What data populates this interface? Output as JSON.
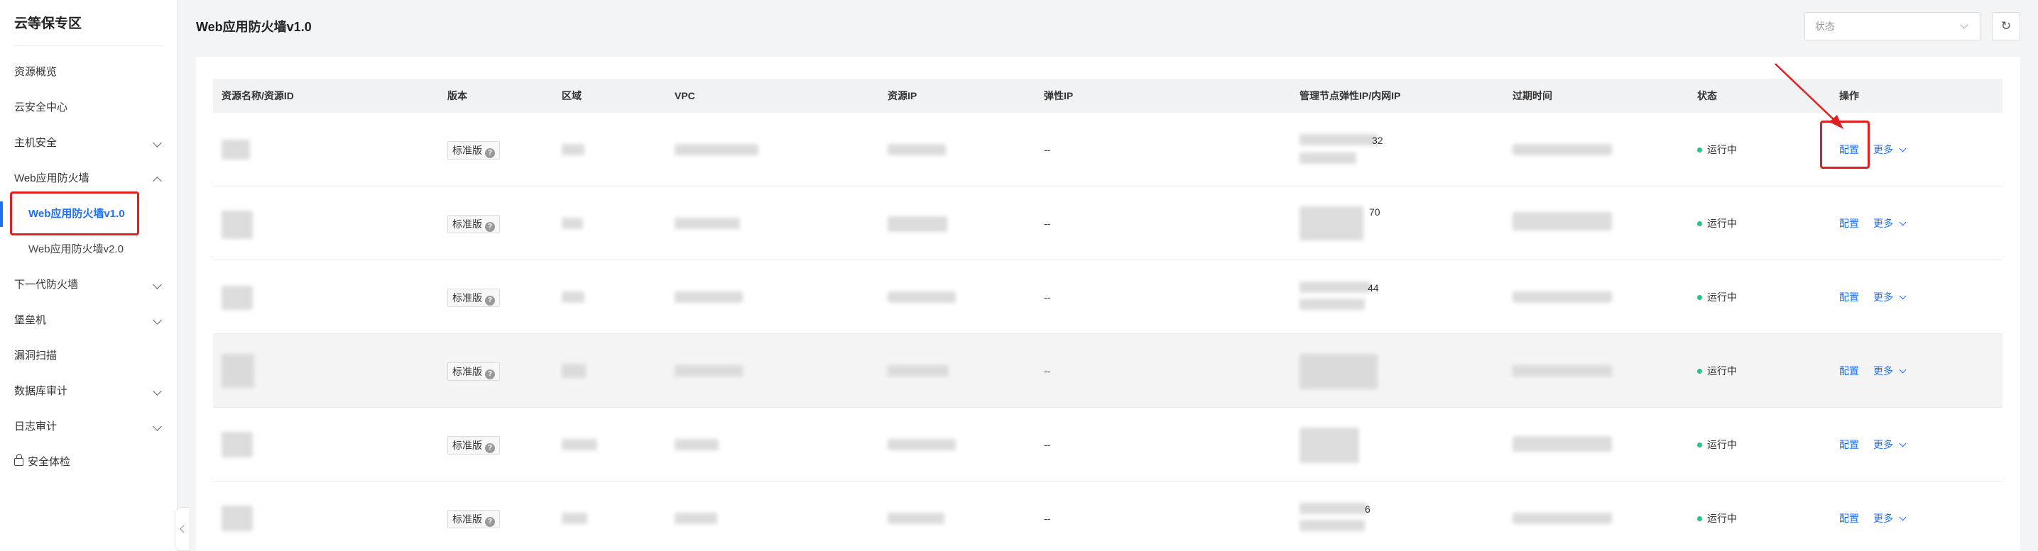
{
  "sidebar": {
    "brand": "云等保专区",
    "items": [
      {
        "label": "资源概览"
      },
      {
        "label": "云安全中心"
      },
      {
        "label": "主机安全"
      },
      {
        "label": "Web应用防火墙"
      },
      {
        "label": "Web应用防火墙v1.0"
      },
      {
        "label": "Web应用防火墙v2.0"
      },
      {
        "label": "下一代防火墙"
      },
      {
        "label": "堡垒机"
      },
      {
        "label": "漏洞扫描"
      },
      {
        "label": "数据库审计"
      },
      {
        "label": "日志审计"
      },
      {
        "label": "安全体检"
      }
    ]
  },
  "header": {
    "title": "Web应用防火墙v1.0",
    "status_placeholder": "状态",
    "refresh_icon": "refresh-icon"
  },
  "table": {
    "columns": [
      "资源名称/资源ID",
      "版本",
      "区域",
      "VPC",
      "资源IP",
      "弹性IP",
      "管理节点弹性IP/内网IP",
      "过期时间",
      "状态",
      "操作"
    ],
    "rows": [
      {
        "mgmt_ip_fragment": "32",
        "version": "标准版",
        "eip": "--",
        "status": "运行中",
        "configure": "配置",
        "more": "更多"
      },
      {
        "mgmt_ip_fragment": "70",
        "version": "标准版",
        "eip": "--",
        "status": "运行中",
        "configure": "配置",
        "more": "更多"
      },
      {
        "mgmt_ip_fragment": "44",
        "version": "标准版",
        "eip": "--",
        "status": "运行中",
        "configure": "配置",
        "more": "更多"
      },
      {
        "mgmt_ip_fragment": "",
        "version": "标准版",
        "eip": "--",
        "status": "运行中",
        "configure": "配置",
        "more": "更多"
      },
      {
        "mgmt_ip_fragment": "",
        "version": "标准版",
        "eip": "--",
        "status": "运行中",
        "configure": "配置",
        "more": "更多"
      },
      {
        "mgmt_ip_fragment": "6",
        "version": "标准版",
        "eip": "--",
        "status": "运行中",
        "configure": "配置",
        "more": "更多"
      }
    ]
  },
  "colors": {
    "accent": "#1f6fff",
    "running": "#2ec27e",
    "highlight_box": "#e02020"
  }
}
